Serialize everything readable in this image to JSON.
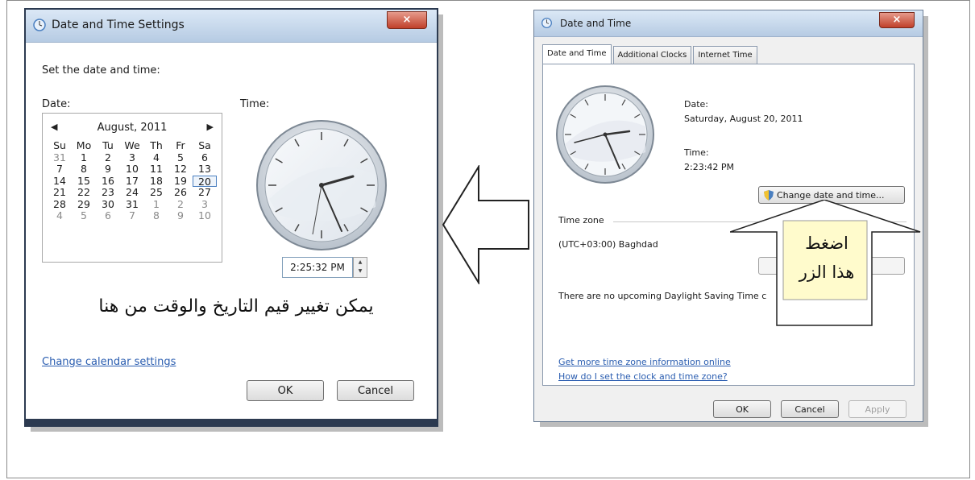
{
  "left_dialog": {
    "title": "Date and Time Settings",
    "close": "×",
    "instruction": "Set the date and time:",
    "date_label": "Date:",
    "time_label": "Time:",
    "calendar": {
      "prev": "◀",
      "next": "▶",
      "month": "August, 2011",
      "weekdays": [
        "Su",
        "Mo",
        "Tu",
        "We",
        "Th",
        "Fr",
        "Sa"
      ],
      "weeks": [
        [
          "31",
          "1",
          "2",
          "3",
          "4",
          "5",
          "6"
        ],
        [
          "7",
          "8",
          "9",
          "10",
          "11",
          "12",
          "13"
        ],
        [
          "14",
          "15",
          "16",
          "17",
          "18",
          "19",
          "20"
        ],
        [
          "21",
          "22",
          "23",
          "24",
          "25",
          "26",
          "27"
        ],
        [
          "28",
          "29",
          "30",
          "31",
          "1",
          "2",
          "3"
        ],
        [
          "4",
          "5",
          "6",
          "7",
          "8",
          "9",
          "10"
        ]
      ],
      "selected_day": "20"
    },
    "time_value": "2:25:32 PM",
    "note_arabic": "يمكن تغيير قيم التاريخ والوقت من هنا",
    "calendar_link": "Change calendar settings",
    "ok": "OK",
    "cancel": "Cancel"
  },
  "right_dialog": {
    "title": "Date and Time",
    "close": "×",
    "tabs": [
      "Date and Time",
      "Additional Clocks",
      "Internet Time"
    ],
    "date_label": "Date:",
    "date_value": "Saturday, August 20, 2011",
    "time_label": "Time:",
    "time_value": "2:23:42 PM",
    "change_button": "Change date and time...",
    "timezone_header": "Time zone",
    "timezone_value": "(UTC+03:00) Baghdad",
    "dst_text": "There are no upcoming Daylight Saving Time c",
    "link_more": "Get more time zone information online",
    "link_help": "How do I set the clock and time zone?",
    "ok": "OK",
    "cancel": "Cancel",
    "apply": "Apply"
  },
  "callout": {
    "line1": "اضغط",
    "line2": "هذا الزر"
  },
  "colors": {
    "title_gradient": "#c6d7ec",
    "close_red": "#c0402a",
    "link_blue": "#2a5db0",
    "callout_fill": "#fffbcc"
  }
}
